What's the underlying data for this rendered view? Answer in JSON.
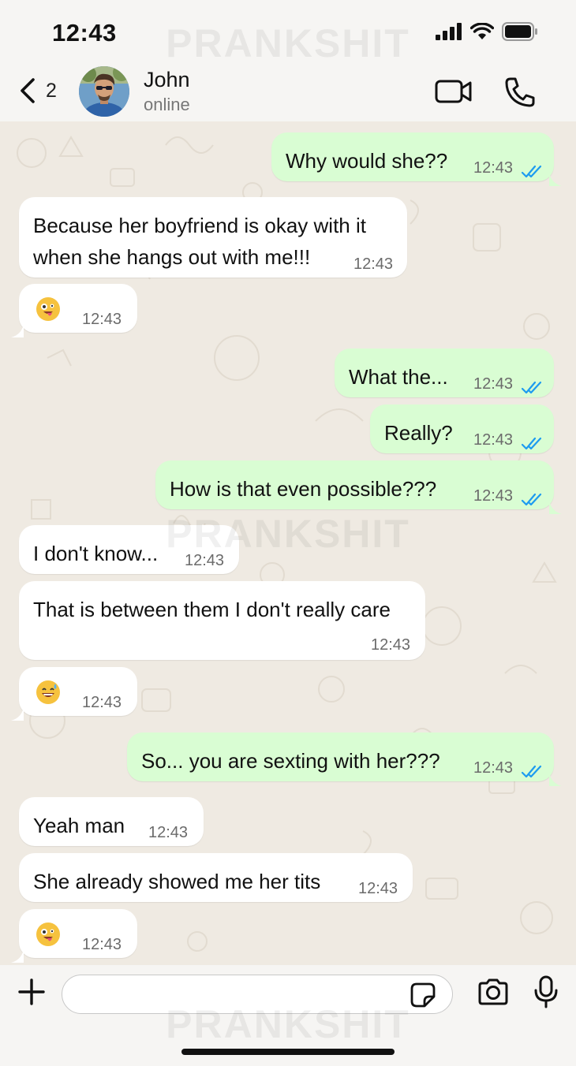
{
  "status_bar": {
    "time": "12:43"
  },
  "watermark": "PRANKSHIT",
  "header": {
    "back_count": "2",
    "contact_name": "John",
    "contact_status": "online"
  },
  "messages": [
    {
      "dir": "out",
      "text": "Why would she??",
      "time": "12:43",
      "read": true
    },
    {
      "dir": "in",
      "text": "Because her boyfriend is okay with it\nwhen she hangs out with me!!!",
      "time": "12:43"
    },
    {
      "dir": "in",
      "emoji": "zany-face",
      "time": "12:43"
    },
    {
      "dir": "out",
      "text": "What the...",
      "time": "12:43",
      "read": true
    },
    {
      "dir": "out",
      "text": "Really?",
      "time": "12:43",
      "read": true
    },
    {
      "dir": "out",
      "text": "How is that even possible???",
      "time": "12:43",
      "read": true
    },
    {
      "dir": "in",
      "text": "I don't know...",
      "time": "12:43"
    },
    {
      "dir": "in",
      "text": "That is between them I don't really care",
      "time": "12:43"
    },
    {
      "dir": "in",
      "emoji": "grinning-sweat-face",
      "time": "12:43"
    },
    {
      "dir": "out",
      "text": "So... you are sexting with her???",
      "time": "12:43",
      "read": true
    },
    {
      "dir": "in",
      "text": "Yeah man",
      "time": "12:43"
    },
    {
      "dir": "in",
      "text": "She already showed me her tits",
      "time": "12:43"
    },
    {
      "dir": "in",
      "emoji": "zany-face",
      "time": "12:43"
    }
  ],
  "composer": {
    "placeholder": "",
    "value": ""
  },
  "colors": {
    "outgoing_bubble": "#d9fdd3",
    "incoming_bubble": "#ffffff",
    "read_ticks": "#1d9bf0",
    "chat_background": "#efeae2"
  }
}
